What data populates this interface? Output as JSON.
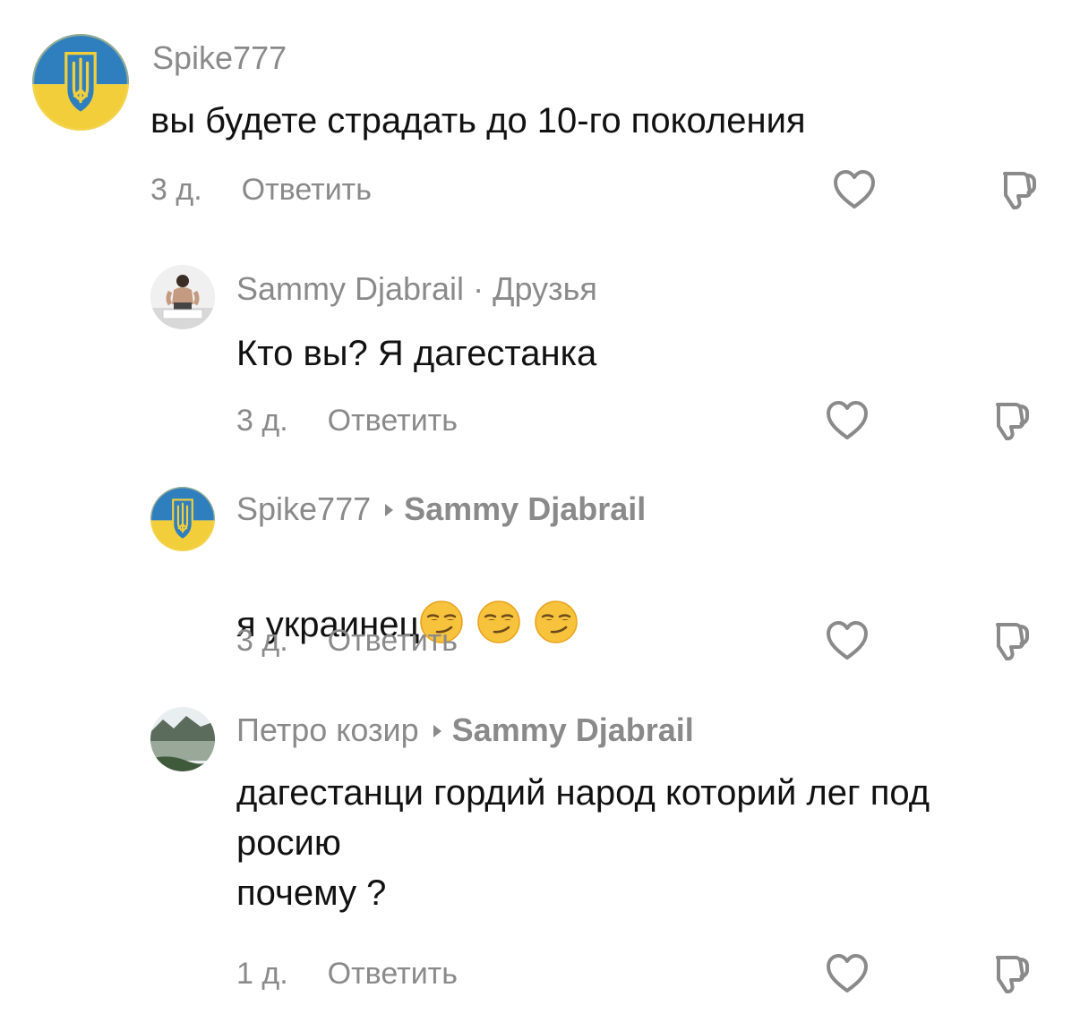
{
  "comments": [
    {
      "author": "Spike777",
      "text": "вы будете страдать до 10-го поколения",
      "time": "3 д.",
      "reply_label": "Ответить"
    },
    {
      "author": "Sammy Djabrail",
      "separator": "·",
      "badge": "Друзья",
      "text": "Кто вы? Я дагестанка",
      "time": "3 д.",
      "reply_label": "Ответить"
    },
    {
      "author": "Spike777",
      "reply_to": "Sammy Djabrail",
      "text": "я украинец",
      "time": "3 д.",
      "reply_label": "Ответить"
    },
    {
      "author": "Петро козир",
      "reply_to": "Sammy Djabrail",
      "text": "дагестанци гордий народ которий лег под\nросию\nпочему ?",
      "time": "1 д.",
      "reply_label": "Ответить"
    }
  ],
  "icons": {
    "like": "heart-icon",
    "dislike": "thumbs-down-icon",
    "emoji": "smirking-face-emoji"
  },
  "colors": {
    "ukraine_blue": "#2f7fbf",
    "ukraine_yellow": "#f2cf3a",
    "muted_text": "#8a8a8a"
  }
}
